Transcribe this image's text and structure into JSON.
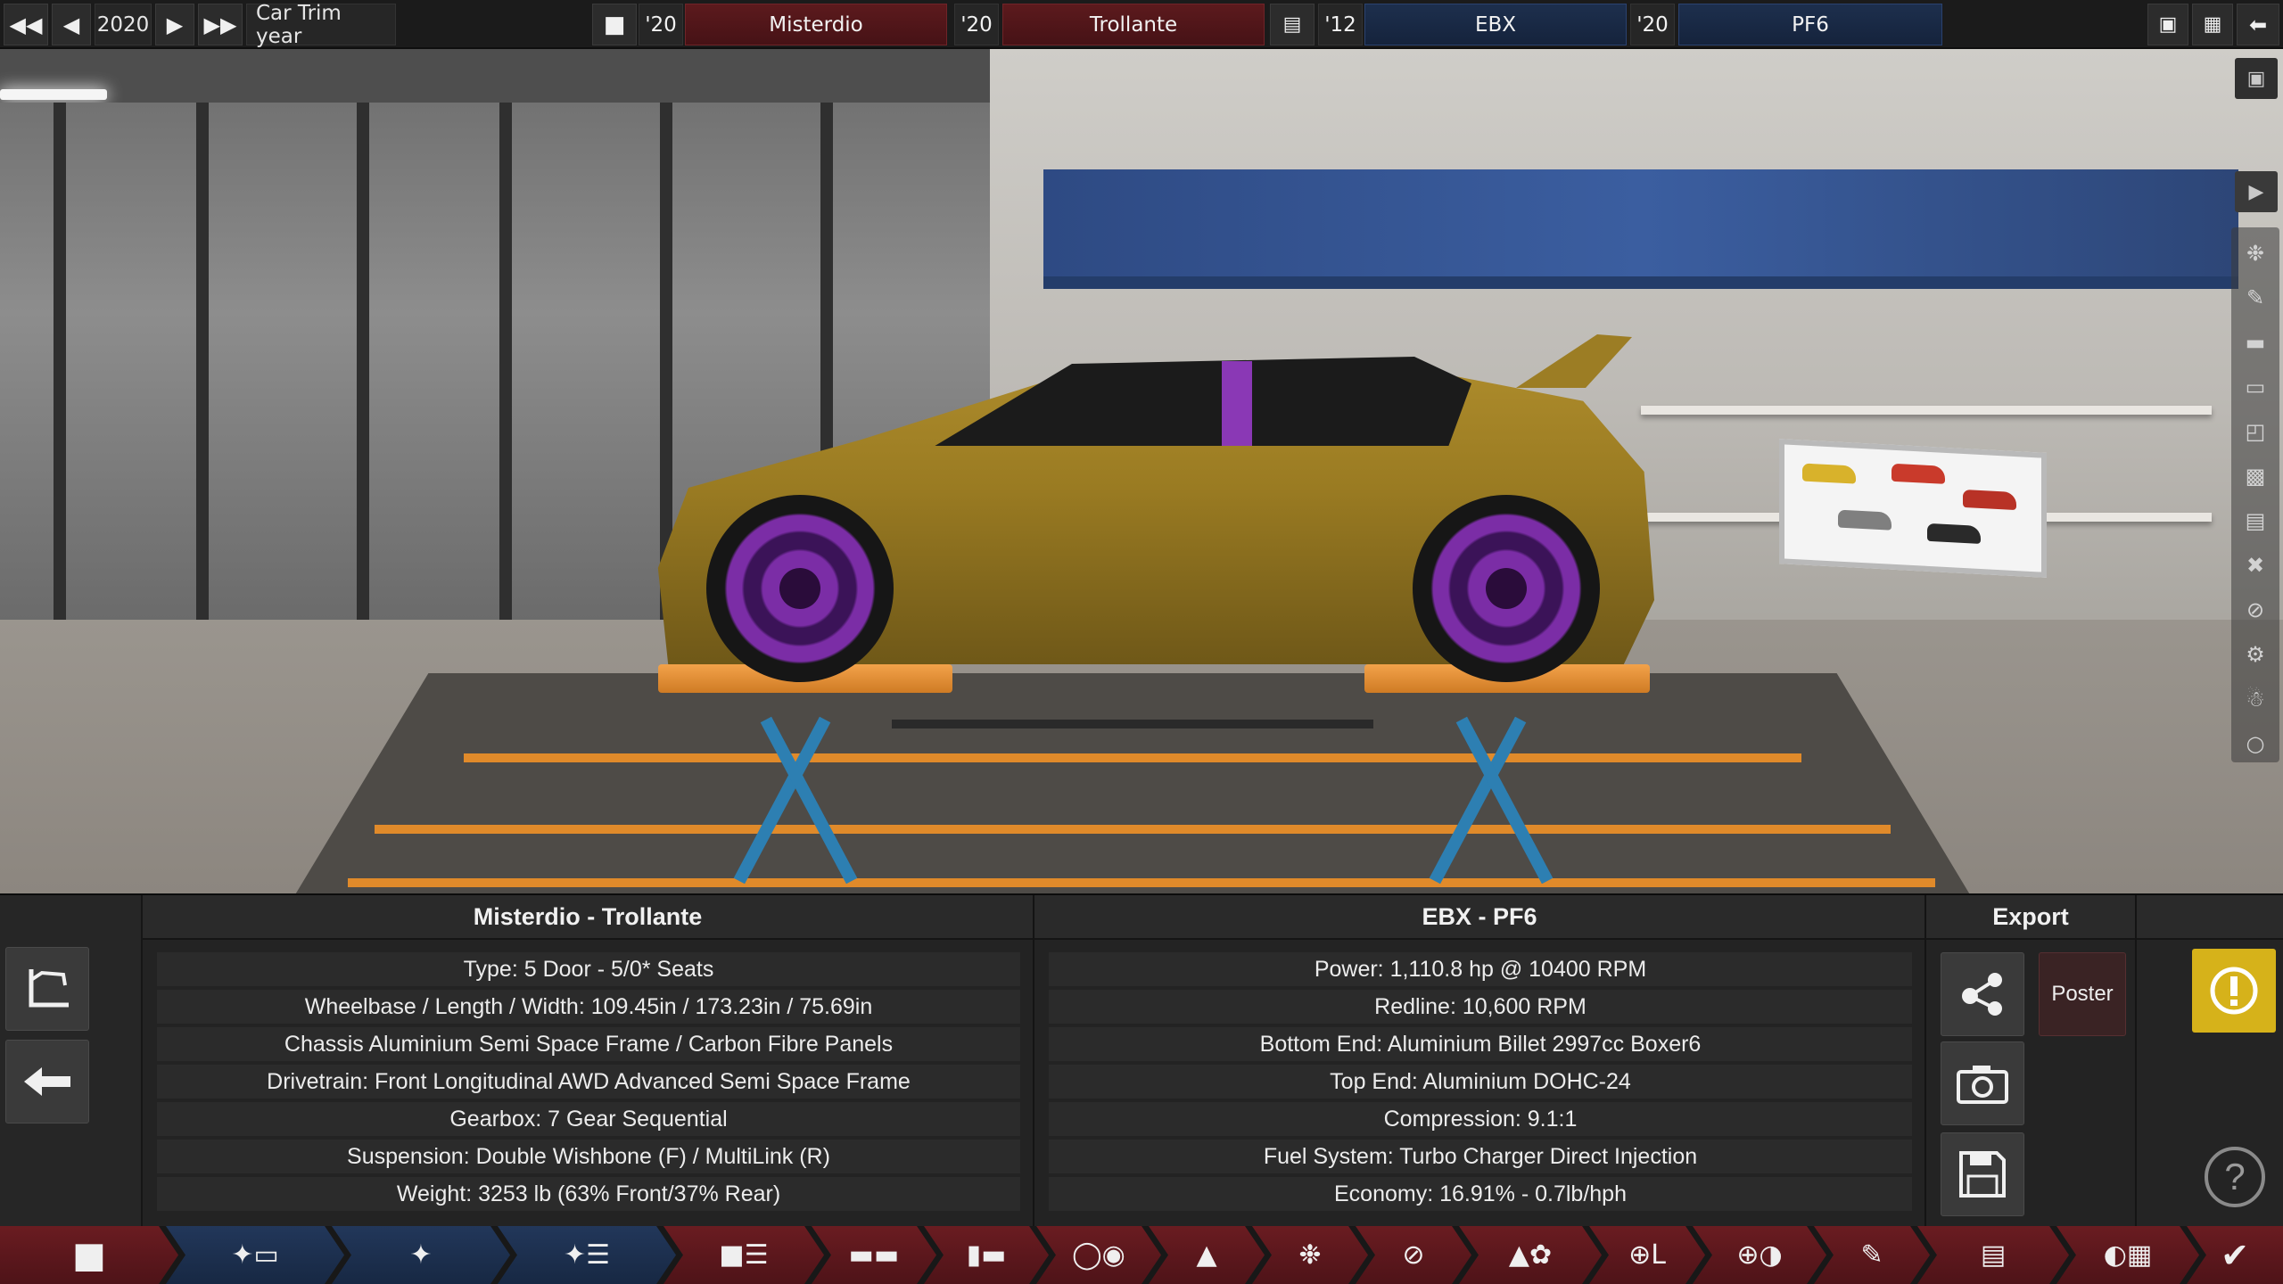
{
  "topbar": {
    "year": "2020",
    "year_label": "Car Trim year",
    "model_year": "'20",
    "model_name": "Misterdio",
    "trim_year": "'20",
    "trim_name": "Trollante",
    "engine_family_year": "'12",
    "engine_family_name": "EBX",
    "engine_variant_year": "'20",
    "engine_variant_name": "PF6"
  },
  "panel": {
    "car_title": "Misterdio - Trollante",
    "car_rows": [
      "Type: 5 Door - 5/0* Seats",
      "Wheelbase / Length / Width: 109.45in / 173.23in / 75.69in",
      "Chassis Aluminium Semi Space Frame / Carbon Fibre Panels",
      "Drivetrain: Front Longitudinal AWD Advanced Semi Space Frame",
      "Gearbox: 7 Gear Sequential",
      "Suspension: Double Wishbone (F) / MultiLink (R)",
      "Weight: 3253 lb (63% Front/37% Rear)"
    ],
    "engine_title": "EBX - PF6",
    "engine_rows": [
      "Power: 1,110.8 hp @ 10400 RPM",
      "Redline:  10,600 RPM",
      "Bottom End: Aluminium Billet 2997cc Boxer6",
      "Top End: Aluminium DOHC-24",
      "Compression: 9.1:1",
      "Fuel System: Turbo Charger Direct Injection",
      "Economy: 16.91% - 0.7lb/hph"
    ],
    "export_title": "Export",
    "poster_label": "Poster",
    "help_label": "?"
  },
  "colors": {
    "accent_red": "#5c1a1d",
    "accent_blue": "#1d2f4d",
    "warning_yellow": "#d6b21a",
    "car_paint": "#a4852a",
    "rim_purple": "#7b2da6"
  },
  "icons": {
    "first": "double-left-arrow-icon",
    "prev": "left-arrow-icon",
    "next": "right-arrow-icon",
    "last": "double-right-arrow-icon"
  }
}
